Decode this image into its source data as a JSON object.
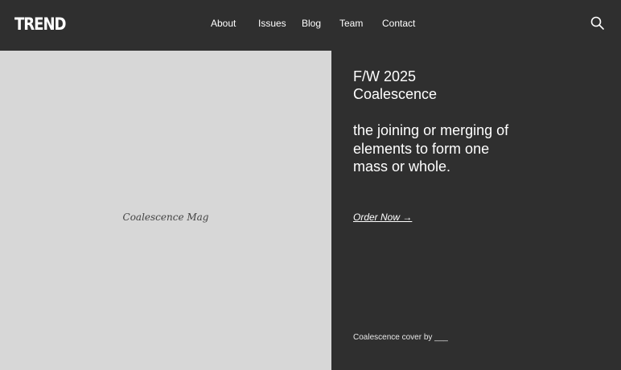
{
  "header": {
    "logo": "TREND",
    "nav": [
      "About",
      "Issues",
      "Blog",
      "Team",
      "Contact"
    ],
    "search_icon": "search-icon"
  },
  "left": {
    "caption": "Coalescence Mag"
  },
  "right": {
    "season": "F/W 2025",
    "collection": "Coalescence",
    "definition": "the joining or merging of elements to form one mass or whole.",
    "order_link": "Order Now →",
    "credit": "Coalescence cover by ___"
  },
  "colors": {
    "background": "#2f2f2f",
    "image_placeholder": "#d7d7d7",
    "text": "#ffffff"
  }
}
